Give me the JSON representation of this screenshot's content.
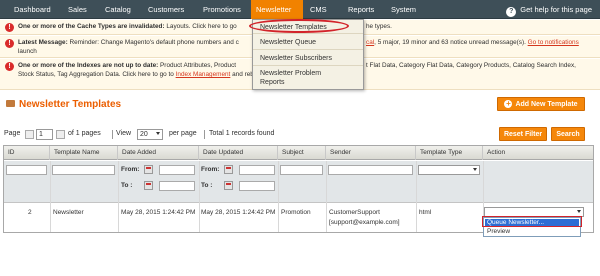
{
  "nav": {
    "items": [
      "Dashboard",
      "Sales",
      "Catalog",
      "Customers",
      "Promotions",
      "Newsletter",
      "CMS",
      "Reports",
      "System"
    ],
    "help": "Get help for this page"
  },
  "messages": {
    "cache": {
      "lead": "One or more of the Cache Types are invalidated:",
      "text": "Layouts. Click here to go",
      "tail": "he types."
    },
    "latest": {
      "lead": "Latest Message:",
      "text": "Reminder: Change Magento's default phone numbers and c",
      "critical": "cal",
      "tail": ", 5 major, 19 minor and 63 notice unread message(s).",
      "link": "Go to notifications",
      "line2": "launch"
    },
    "indexes": {
      "lead": "One or more of the Indexes are not up to date:",
      "text": "Product Attributes, Product",
      "tail": "t Flat Data, Category Flat Data, Category Products, Catalog Search Index,",
      "line2": "Stock Status, Tag Aggregation Data. Click here to go to",
      "link": "Index Management",
      "line2_tail": "and rebuild the required indexes."
    }
  },
  "dropdown": {
    "items": [
      "Newsletter Templates",
      "Newsletter Queue",
      "Newsletter Subscribers",
      "Newsletter Problem",
      "Reports"
    ]
  },
  "page": {
    "title": "Newsletter Templates",
    "add_button": "Add New Template"
  },
  "pager": {
    "page_label": "Page",
    "page_value": "1",
    "of_pages": "of 1 pages",
    "view_label": "View",
    "view_value": "20",
    "per_page": "per page",
    "total": "Total 1 records found",
    "reset": "Reset Filter",
    "search": "Search"
  },
  "grid": {
    "columns": [
      "ID",
      "Template Name",
      "Date Added",
      "Date Updated",
      "Subject",
      "Sender",
      "Template Type",
      "Action"
    ],
    "filter_from": "From:",
    "filter_to": "To :",
    "row": {
      "id": "2",
      "name": "Newsletter",
      "added": "May 28, 2015 1:24:42 PM",
      "updated": "May 28, 2015 1:24:42 PM",
      "subject": "Promotion",
      "sender": "CustomerSupport",
      "sender_email": "[support@example.com]",
      "type": "html"
    },
    "action_options": [
      "Queue Newsletter...",
      "Preview"
    ]
  },
  "colors": {
    "nav_bg": "#3e4f58",
    "accent": "#f18200",
    "title": "#eb5e00",
    "highlight": "#d2232a"
  }
}
